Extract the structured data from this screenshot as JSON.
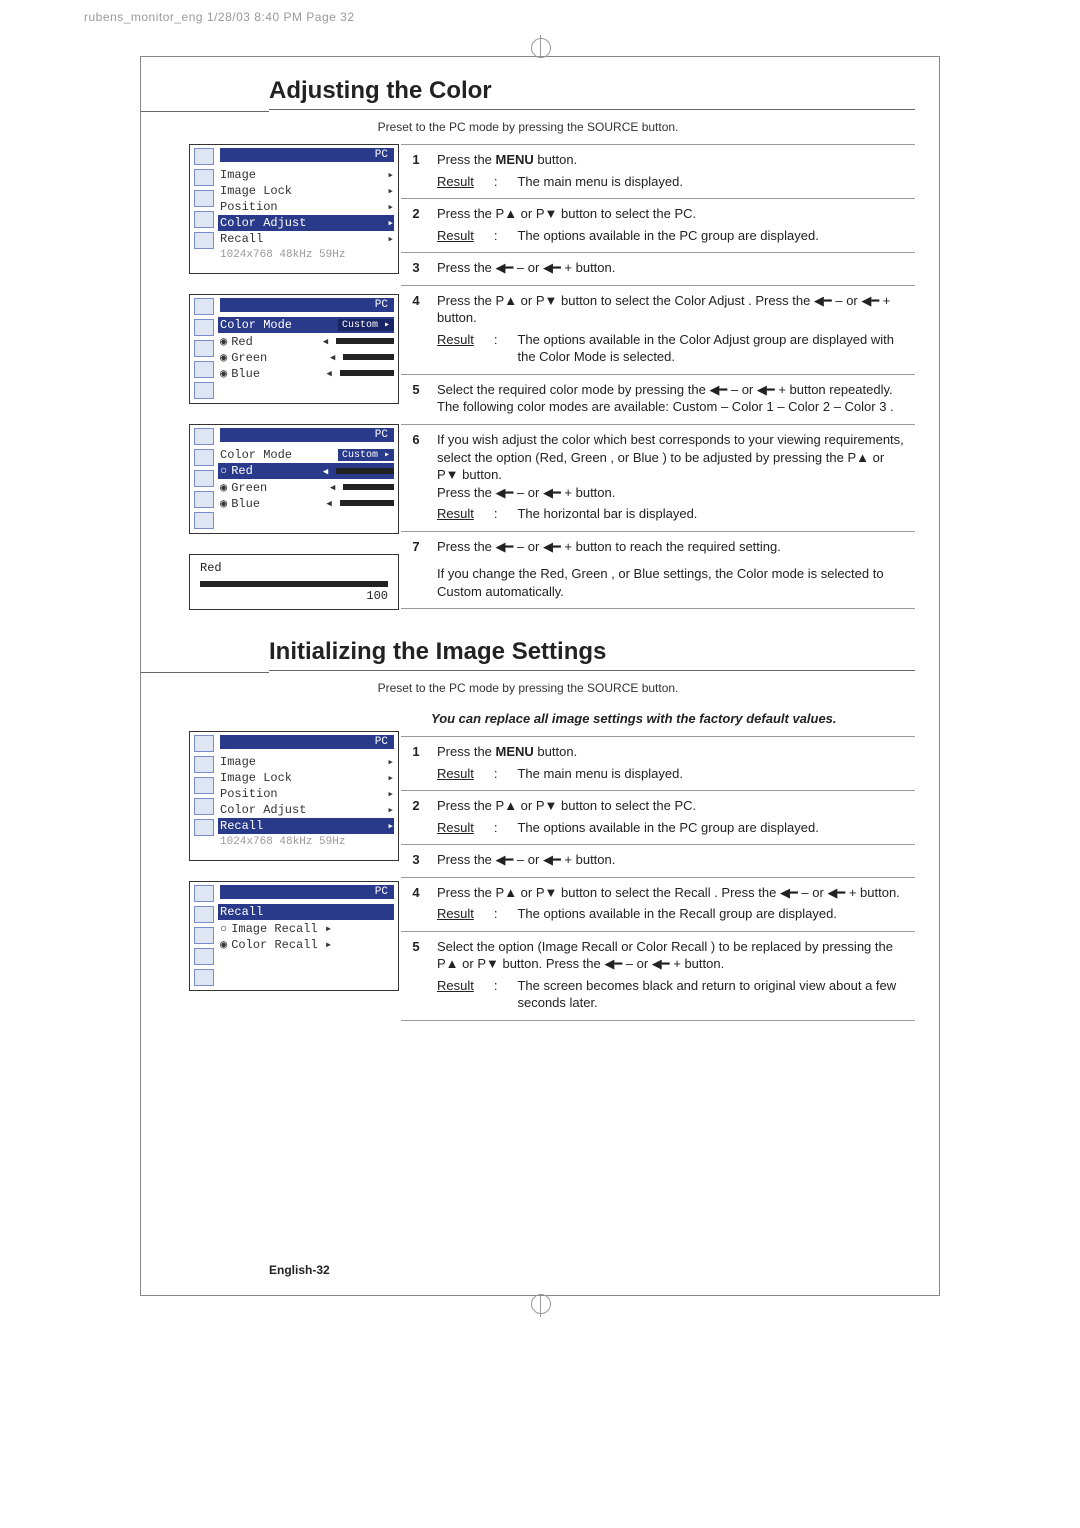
{
  "imposition": "rubens_monitor_eng  1/28/03 8:40 PM  Page 32",
  "section1": {
    "heading": "Adjusting the Color",
    "preset": "Preset to the PC mode by pressing the SOURCE button.",
    "osd1_title": "PC",
    "osd1": {
      "r1": "Image",
      "r1a": "▸",
      "r2": "Image Lock",
      "r2a": "▸",
      "r3": "Position",
      "r3a": "▸",
      "r4": "Color Adjust",
      "r4a": "▸",
      "r5": "Recall",
      "r5a": "▸",
      "r6": "1024x768    48kHz  59Hz"
    },
    "osd2_title": "PC",
    "osd2": {
      "mode_label": "Color Mode",
      "mode_badge": "Custom ▸",
      "red": "Red",
      "green": "Green",
      "blue": "Blue"
    },
    "osd3_title": "PC",
    "osd3": {
      "mode_label": "Color Mode",
      "mode_badge": "Custom ▸",
      "red": "Red",
      "green": "Green",
      "blue": "Blue"
    },
    "osd4": {
      "label": "Red",
      "value": "100"
    },
    "steps": [
      {
        "n": "1",
        "body": "Press the <b>MENU</b> button.",
        "result": "The main menu is displayed."
      },
      {
        "n": "2",
        "body": "Press the P▲ or P▼ button to select the PC.",
        "result": "The options available in the PC group are displayed."
      },
      {
        "n": "3",
        "body": "Press the ◀━ – or ◀━ + button."
      },
      {
        "n": "4",
        "body": "Press the P▲ or P▼ button to select the Color Adjust . Press the ◀━ – or ◀━ + button.",
        "result": "The options available in the Color Adjust group are displayed with the Color Mode is selected."
      },
      {
        "n": "5",
        "body": "Select the required color mode by pressing the ◀━ – or ◀━ + button repeatedly. The following color modes are available: Custom  –  Color 1  –  Color 2  –  Color 3 ."
      },
      {
        "n": "6",
        "body": "If you wish adjust the color which best corresponds to your viewing requirements, select the option (Red, Green , or Blue ) to be adjusted by pressing the P▲ or P▼ button.<br>Press the ◀━ – or ◀━ + button.",
        "result": "The horizontal bar is displayed."
      },
      {
        "n": "7",
        "body": "Press the ◀━ – or ◀━ + button to reach the required setting.",
        "note": "If you change the Red, Green , or Blue  settings, the Color mode  is selected to Custom  automatically."
      }
    ]
  },
  "section2": {
    "heading": "Initializing the Image Settings",
    "preset": "Preset to the PC mode by pressing the SOURCE button.",
    "intro": "You can replace all image settings with the factory default values.",
    "osd1_title": "PC",
    "osd1": {
      "r1": "Image",
      "r1a": "▸",
      "r2": "Image Lock",
      "r2a": "▸",
      "r3": "Position",
      "r3a": "▸",
      "r4": "Color Adjust",
      "r4a": "▸",
      "r5": "Recall",
      "r5a": "▸",
      "r6": "1024x768    48kHz  59Hz"
    },
    "osd2_title": "PC",
    "osd2": {
      "recall": "Recall",
      "image_recall": "Image Recall ▸",
      "color_recall": "Color Recall ▸"
    },
    "steps": [
      {
        "n": "1",
        "body": "Press the <b>MENU</b> button.",
        "result": "The main menu is displayed."
      },
      {
        "n": "2",
        "body": "Press the P▲ or P▼ button to select the PC.",
        "result": "The options available in the PC group are displayed."
      },
      {
        "n": "3",
        "body": "Press the ◀━ – or ◀━ + button."
      },
      {
        "n": "4",
        "body": "Press the P▲ or P▼ button to select the Recall . Press the ◀━ – or ◀━ + button.",
        "result": "The options available in the Recall  group are displayed."
      },
      {
        "n": "5",
        "body": "Select the option (Image Recall  or Color Recall ) to be replaced by pressing the P▲ or P▼ button. Press the ◀━ – or ◀━ + button.",
        "result": "The screen becomes black and return to original view about a few seconds later."
      }
    ]
  },
  "footer": "English-32"
}
